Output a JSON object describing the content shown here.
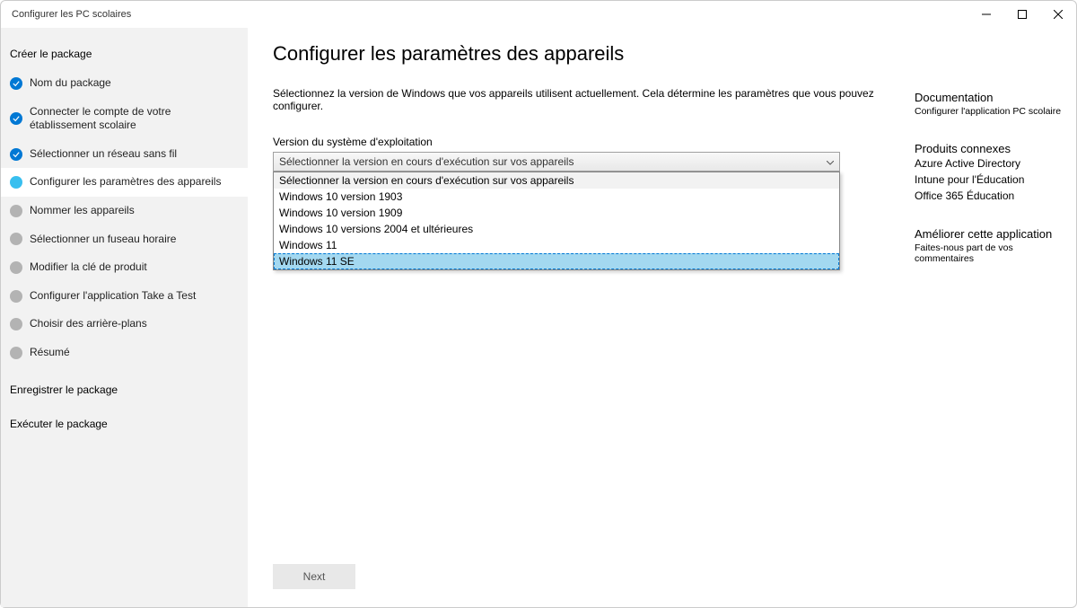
{
  "window": {
    "title": "Configurer les PC scolaires"
  },
  "sidebar": {
    "header": "Créer le package",
    "items": [
      {
        "label": "Nom du package",
        "state": "done"
      },
      {
        "label": "Connecter le compte de votre établissement scolaire",
        "state": "done"
      },
      {
        "label": "Sélectionner un réseau sans fil",
        "state": "done"
      },
      {
        "label": "Configurer les paramètres des appareils",
        "state": "current"
      },
      {
        "label": "Nommer les appareils",
        "state": "pending"
      },
      {
        "label": "Sélectionner un fuseau horaire",
        "state": "pending"
      },
      {
        "label": "Modifier la clé de produit",
        "state": "pending"
      },
      {
        "label": "Configurer l'application Take a Test",
        "state": "pending"
      },
      {
        "label": "Choisir des arrière-plans",
        "state": "pending"
      },
      {
        "label": "Résumé",
        "state": "pending"
      }
    ],
    "sections": [
      {
        "label": "Enregistrer le package"
      },
      {
        "label": "Exécuter le package"
      }
    ]
  },
  "main": {
    "title": "Configurer les paramètres des appareils",
    "desc": "Sélectionnez la version de Windows que vos appareils utilisent actuellement. Cela détermine les paramètres que vous pouvez configurer.",
    "field_label": "Version du système d'exploitation",
    "select_value": "Sélectionner la version en cours d'exécution sur vos appareils",
    "options": [
      {
        "label": "Sélectionner la version en cours d'exécution sur vos appareils",
        "placeholder": true
      },
      {
        "label": "Windows 10 version 1903"
      },
      {
        "label": "Windows 10 version 1909"
      },
      {
        "label": "Windows 10 versions 2004 et ultérieures"
      },
      {
        "label": "Windows 11"
      },
      {
        "label": "Windows 11  SE",
        "highlighted": true
      }
    ],
    "next_label": "Next"
  },
  "right": {
    "doc_header": "Documentation",
    "doc_link": "Configurer l'application PC scolaire",
    "products_header": "Produits connexes",
    "products": [
      "Azure Active Directory",
      "Intune pour l'Éducation",
      "Office 365 Éducation"
    ],
    "improve_header": "Améliorer cette application",
    "improve_link": "Faites-nous part de vos commentaires"
  }
}
